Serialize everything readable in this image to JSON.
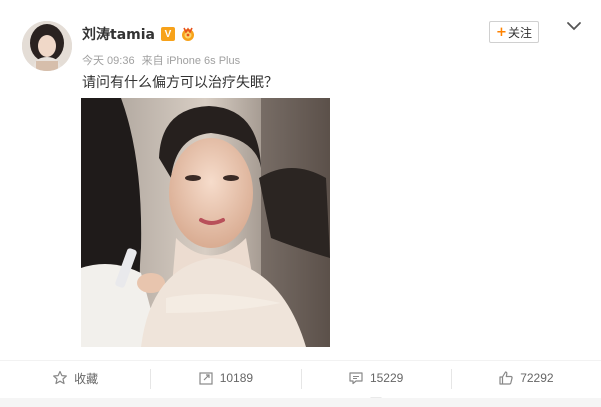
{
  "post": {
    "username": "刘涛tamia",
    "verified_badge": "V",
    "medal_icon": "medal-icon",
    "timestamp": "今天 09:36",
    "source": "来自 iPhone 6s Plus",
    "content": "请问有什么偏方可以治疗失眠？",
    "follow_label": "关注",
    "follow_plus": "+",
    "accent_color": "#ff8200"
  },
  "actions": {
    "favorite_label": "收藏",
    "repost_count": "10189",
    "comment_count": "15229",
    "like_count": "72292"
  },
  "icons": {
    "more": "chevron-down-icon",
    "favorite": "star-icon",
    "repost": "repost-icon",
    "comment": "comment-icon",
    "like": "thumbs-up-icon"
  }
}
